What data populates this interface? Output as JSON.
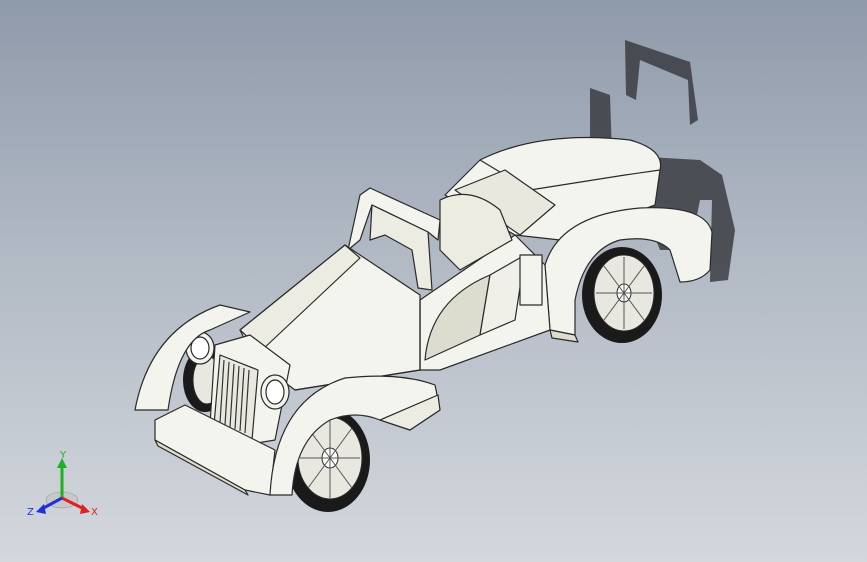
{
  "triad": {
    "y_label": "Y",
    "x_label": "X",
    "z_label": "Z"
  },
  "colors": {
    "background_top": "#8f9aaa",
    "background_bottom": "#d4d8dd",
    "body": "#f4f4ee",
    "body_shade": "#dcdccf",
    "outline": "#2a2a2a",
    "tire": "#1a1a1a",
    "shadow": "#3b3d42",
    "axis_x": "#e02020",
    "axis_y": "#20b020",
    "axis_z": "#2030e0"
  },
  "icons": {
    "triad": "coordinate-triad-icon"
  }
}
